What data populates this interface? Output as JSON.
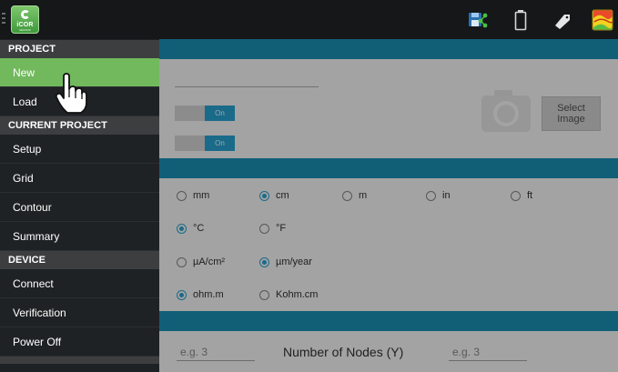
{
  "app": {
    "logo_text": "iCOR",
    "logo_sub": "SENSOR"
  },
  "toolbar": {
    "actions": [
      {
        "icon": "save-share-icon"
      },
      {
        "icon": "battery-icon"
      },
      {
        "icon": "tag-icon"
      },
      {
        "icon": "contour-map-icon"
      }
    ]
  },
  "drawer": {
    "project_header": "PROJECT",
    "new_label": "New",
    "load_label": "Load",
    "current_header": "CURRENT PROJECT",
    "setup_label": "Setup",
    "grid_label": "Grid",
    "contour_label": "Contour",
    "summary_label": "Summary",
    "device_header": "DEVICE",
    "connect_label": "Connect",
    "verification_label": "Verification",
    "poweroff_label": "Power Off",
    "selected": "New"
  },
  "content": {
    "toggle1_label": "On",
    "toggle2_label": "On",
    "select_image_label": "Select\nImage",
    "length_units": {
      "options": [
        "mm",
        "cm",
        "m",
        "in",
        "ft"
      ],
      "selected": "cm"
    },
    "temp_units": {
      "options": [
        "°C",
        "°F"
      ],
      "selected": "°C"
    },
    "rate_units": {
      "options": [
        "µA/cm²",
        "µm/year"
      ],
      "selected": "µm/year"
    },
    "resistivity_units": {
      "options": [
        "ohm.m",
        "Kohm.cm"
      ],
      "selected": "ohm.m"
    },
    "nodes_x_placeholder": "e.g. 3",
    "nodes_y_label": "Number of Nodes (Y)",
    "nodes_y_placeholder": "e.g. 3"
  },
  "colors": {
    "accent": "#2aa8d6",
    "band": "#1c95ba",
    "drawer_bg": "#1f2224",
    "drawer_active": "#72b95d",
    "header_bg": "#3c3e40"
  }
}
